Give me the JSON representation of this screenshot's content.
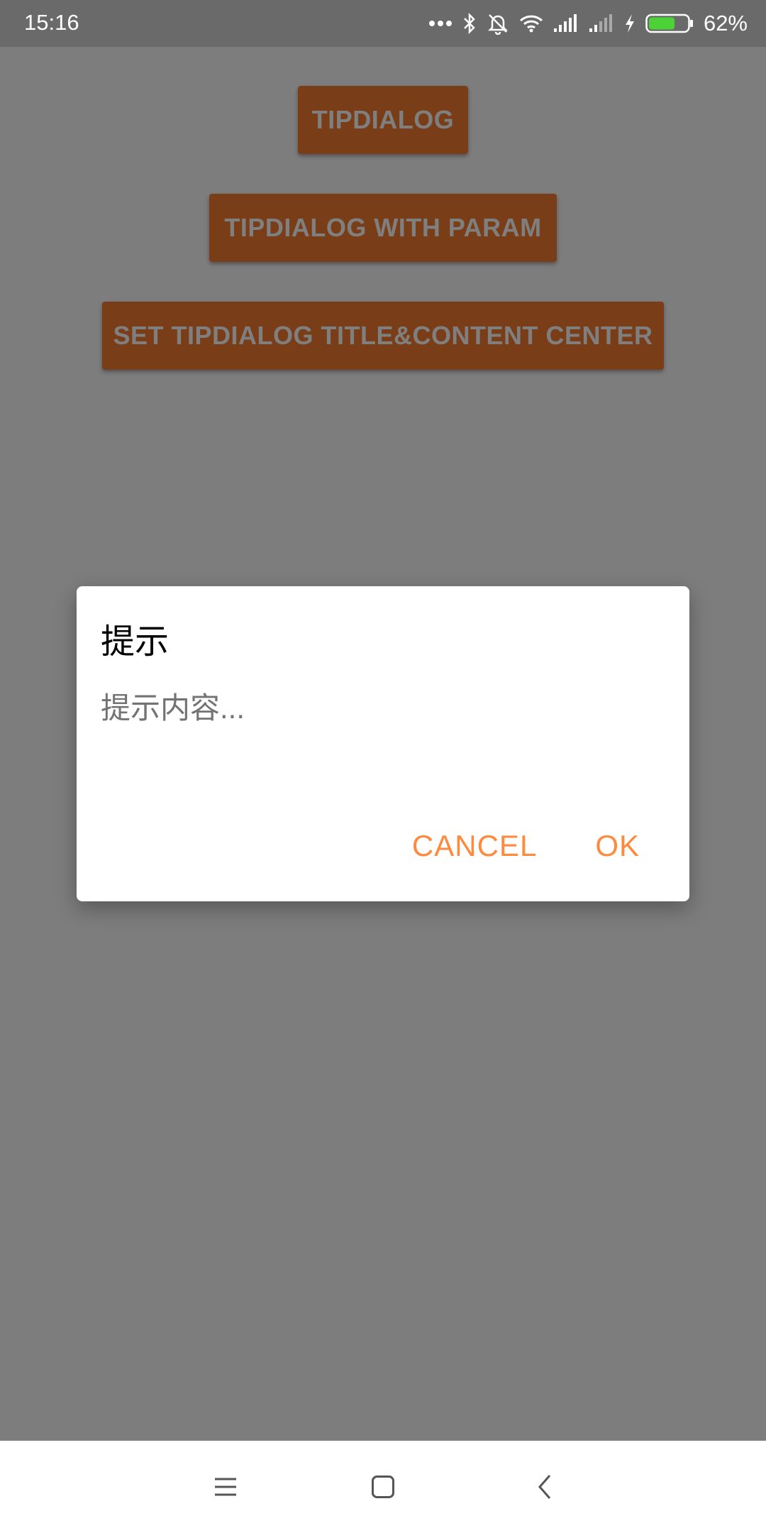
{
  "status_bar": {
    "time": "15:16",
    "battery_percent": "62%",
    "icons": [
      "more-dots-icon",
      "bluetooth-icon",
      "mute-bell-icon",
      "wifi-icon",
      "signal-icon",
      "signal-weak-icon",
      "charging-bolt-icon",
      "battery-icon"
    ]
  },
  "main": {
    "buttons": [
      {
        "label": "TIPDIALOG"
      },
      {
        "label": "TIPDIALOG WITH PARAM"
      },
      {
        "label": "SET TIPDIALOG TITLE&CONTENT CENTER"
      }
    ]
  },
  "dialog": {
    "title": "提示",
    "message": "提示内容...",
    "cancel_label": "CANCEL",
    "ok_label": "OK"
  },
  "nav_bar": {
    "icons": [
      "menu-icon",
      "home-icon",
      "back-icon"
    ]
  },
  "colors": {
    "accent": "#f27a2e",
    "dialog_button": "#ff8a3d",
    "battery_fill": "#4cd137"
  }
}
